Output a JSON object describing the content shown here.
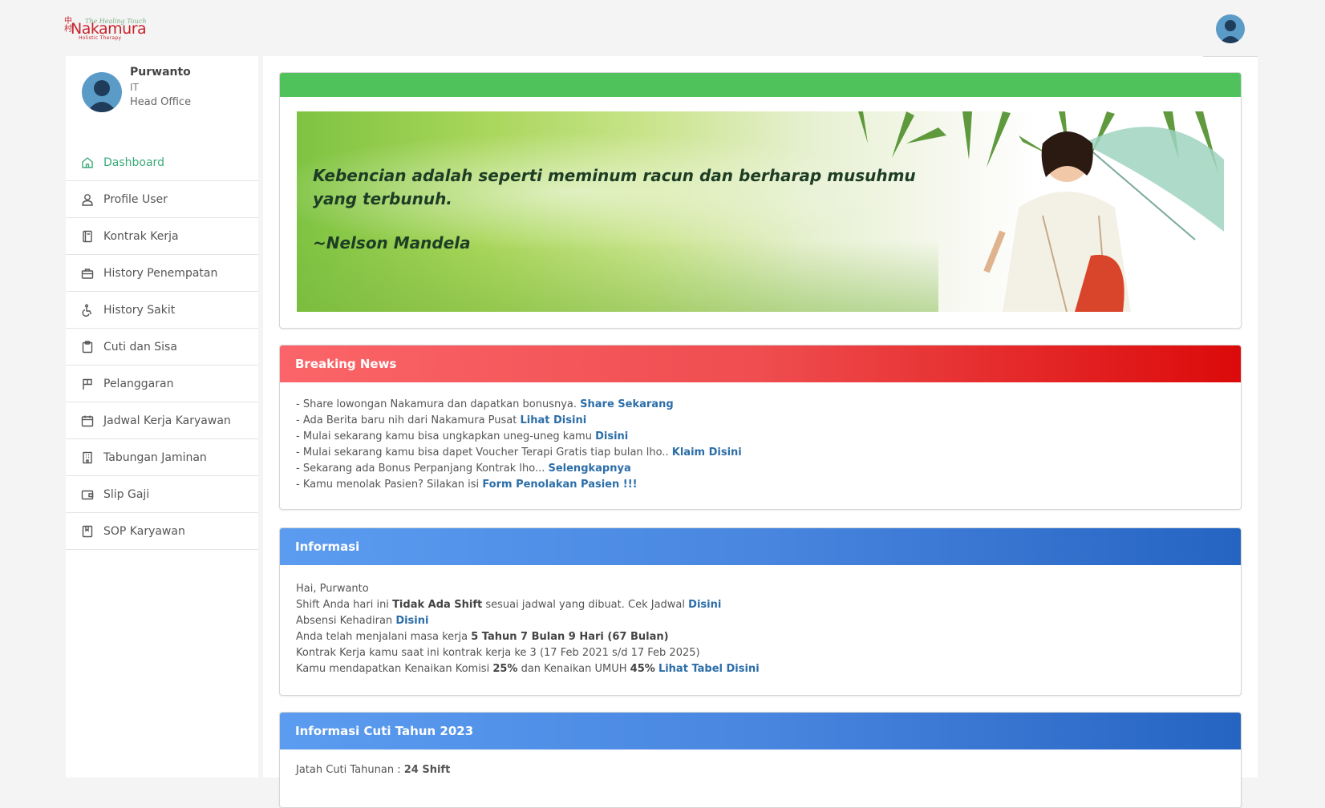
{
  "header": {
    "brand_script": "The Healing Touch",
    "brand_name": "Nakamura",
    "brand_sub": "Holistic Therapy",
    "brand_mark": "中村"
  },
  "profile": {
    "name": "Purwanto",
    "department": "IT",
    "office": "Head Office"
  },
  "sidebar": {
    "items": [
      {
        "label": "Dashboard",
        "icon": "home-icon",
        "active": true
      },
      {
        "label": "Profile User",
        "icon": "user-icon"
      },
      {
        "label": "Kontrak Kerja",
        "icon": "document-icon"
      },
      {
        "label": "History Penempatan",
        "icon": "briefcase-icon"
      },
      {
        "label": "History Sakit",
        "icon": "wheelchair-icon"
      },
      {
        "label": "Cuti dan Sisa",
        "icon": "clipboard-icon"
      },
      {
        "label": "Pelanggaran",
        "icon": "flag-icon"
      },
      {
        "label": "Jadwal Kerja Karyawan",
        "icon": "calendar-icon"
      },
      {
        "label": "Tabungan Jaminan",
        "icon": "building-icon"
      },
      {
        "label": "Slip Gaji",
        "icon": "wallet-icon"
      },
      {
        "label": "SOP Karyawan",
        "icon": "book-icon"
      }
    ]
  },
  "banner": {
    "quote": "Kebencian adalah seperti meminum racun dan berharap musuhmu yang terbunuh.",
    "author": "~Nelson Mandela"
  },
  "news": {
    "title": "Breaking News",
    "items": [
      {
        "text": "- Share lowongan Nakamura dan dapatkan bonusnya. ",
        "link": "Share Sekarang"
      },
      {
        "text": "- Ada Berita baru nih dari Nakamura Pusat ",
        "link": "Lihat Disini"
      },
      {
        "text": "- Mulai sekarang kamu bisa ungkapkan uneg-uneg kamu ",
        "link": "Disini"
      },
      {
        "text": "- Mulai sekarang kamu bisa dapet Voucher Terapi Gratis tiap bulan lho.. ",
        "link": "Klaim Disini"
      },
      {
        "text": "- Sekarang ada Bonus Perpanjang Kontrak lho... ",
        "link": "Selengkapnya"
      },
      {
        "text": "- Kamu menolak Pasien? Silakan isi ",
        "link": "Form Penolakan Pasien !!!"
      }
    ]
  },
  "info": {
    "title": "Informasi",
    "greeting": "Hai, Purwanto",
    "shift_pre": "Shift Anda hari ini ",
    "shift_value": "Tidak Ada Shift",
    "shift_post": " sesuai jadwal yang dibuat. Cek Jadwal ",
    "shift_link": "Disini",
    "absensi_pre": "Absensi Kehadiran ",
    "absensi_link": "Disini",
    "masa_pre": "Anda telah menjalani masa kerja ",
    "masa_value": "5 Tahun 7 Bulan 9 Hari (67 Bulan)",
    "kontrak": "Kontrak Kerja kamu saat ini kontrak kerja ke 3 (17 Feb 2021 s/d 17 Feb 2025)",
    "komisi_pre": "Kamu mendapatkan Kenaikan Komisi ",
    "komisi_value": "25%",
    "umuh_pre": " dan Kenaikan UMUH ",
    "umuh_value": "45%",
    "tabel_link": "Lihat Tabel Disini"
  },
  "cuti": {
    "title": "Informasi Cuti Tahun 2023",
    "jatah_label": "Jatah Cuti Tahunan : ",
    "jatah_value": "24 Shift"
  }
}
